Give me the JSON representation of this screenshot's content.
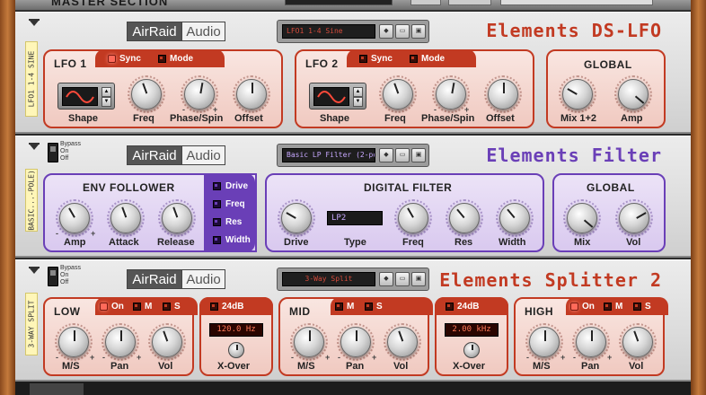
{
  "rack": {
    "top_title": "MASTER SECTION"
  },
  "lfo": {
    "patch_name": "LFO1 1-4 Sine",
    "label": "LFO1 1-4 SINE",
    "title": "Elements DS-LFO",
    "title_color": "#c23a22",
    "logo_a": "AirRaid",
    "logo_b": "Audio",
    "lfo1": {
      "title": "LFO 1",
      "sync": "Sync",
      "mode": "Mode",
      "labels": [
        "Shape",
        "Freq",
        "Phase/Spin",
        "Offset"
      ]
    },
    "lfo2": {
      "title": "LFO 2",
      "sync": "Sync",
      "mode": "Mode",
      "labels": [
        "Shape",
        "Freq",
        "Phase/Spin",
        "Offset"
      ]
    },
    "global": {
      "title": "GLOBAL",
      "labels": [
        "Mix 1+2",
        "Amp"
      ]
    }
  },
  "filter": {
    "patch_name": "Basic LP Filter (2-pole)",
    "label": "BASIC...-POLE)",
    "title": "Elements Filter",
    "title_color": "#6a3fb7",
    "bypass": [
      "Bypass",
      "On",
      "Off"
    ],
    "logo_a": "AirRaid",
    "logo_b": "Audio",
    "env": {
      "title": "ENV FOLLOWER",
      "labels": [
        "Amp",
        "Attack",
        "Release"
      ],
      "targets": [
        "Drive",
        "Freq",
        "Res",
        "Width"
      ]
    },
    "digital": {
      "title": "DIGITAL FILTER",
      "type_value": "LP2",
      "labels": [
        "Drive",
        "Type",
        "Freq",
        "Res",
        "Width"
      ]
    },
    "global": {
      "title": "GLOBAL",
      "labels": [
        "Mix",
        "Vol"
      ]
    }
  },
  "splitter": {
    "patch_name": "3-Way Split",
    "label": "3-WAY SPLIT",
    "title": "Elements Splitter 2",
    "title_color": "#c23a22",
    "bypass": [
      "Bypass",
      "On",
      "Off"
    ],
    "logo_a": "AirRaid",
    "logo_b": "Audio",
    "low": {
      "title": "LOW",
      "on": "On",
      "m": "M",
      "s": "S",
      "labels": [
        "M/S",
        "Pan",
        "Vol"
      ]
    },
    "xover1": {
      "slope": "24dB",
      "value": "120.0 Hz",
      "label": "X-Over"
    },
    "mid": {
      "title": "MID",
      "m": "M",
      "s": "S",
      "labels": [
        "M/S",
        "Pan",
        "Vol"
      ]
    },
    "xover2": {
      "slope": "24dB",
      "value": "2.00 kHz",
      "label": "X-Over"
    },
    "high": {
      "title": "HIGH",
      "on": "On",
      "m": "M",
      "s": "S",
      "labels": [
        "M/S",
        "Pan",
        "Vol"
      ]
    }
  },
  "colors": {
    "lcd_text": "#d44a3a",
    "lcd_purple_text": "#c7a8ff"
  }
}
